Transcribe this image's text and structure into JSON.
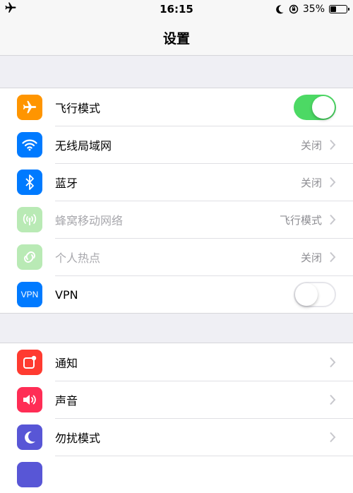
{
  "status_bar": {
    "time": "16:15",
    "battery": "35%",
    "battery_level": 0.35
  },
  "nav": {
    "title": "设置"
  },
  "group1": {
    "items": [
      {
        "label": "飞行模式",
        "icon": "airplane-icon",
        "toggle": true
      },
      {
        "label": "无线局域网",
        "icon": "wifi-icon",
        "value": "关闭"
      },
      {
        "label": "蓝牙",
        "icon": "bluetooth-icon",
        "value": "关闭"
      },
      {
        "label": "蜂窝移动网络",
        "icon": "cellular-icon",
        "value": "飞行模式"
      },
      {
        "label": "个人热点",
        "icon": "hotspot-icon",
        "value": "关闭"
      },
      {
        "label": "VPN",
        "icon": "vpn-icon",
        "icon_text": "VPN",
        "toggle": false
      }
    ]
  },
  "group2": {
    "items": [
      {
        "label": "通知",
        "icon": "notifications-icon"
      },
      {
        "label": "声音",
        "icon": "sounds-icon"
      },
      {
        "label": "勿扰模式",
        "icon": "moon-icon"
      }
    ]
  },
  "colors": {
    "orange": "#ff9500",
    "blue": "#007aff",
    "green": "#4cd964",
    "disabled_green": "#b9eab5",
    "red": "#ff3b30",
    "pink": "#ff2d55",
    "purple": "#5856d6"
  }
}
